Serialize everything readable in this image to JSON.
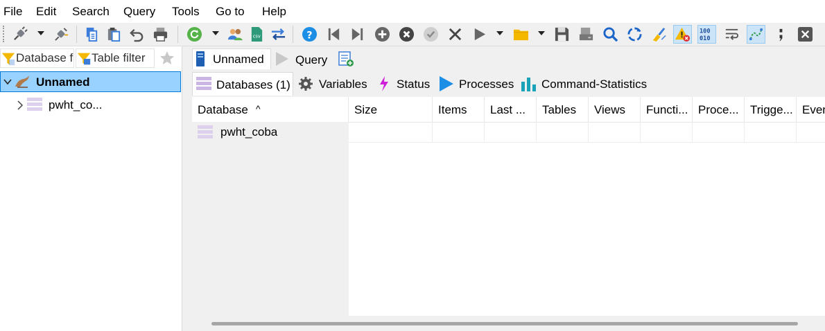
{
  "menu": [
    "File",
    "Edit",
    "Search",
    "Query",
    "Tools",
    "Go to",
    "Help"
  ],
  "left_pane": {
    "database_filter_placeholder": "Database filter",
    "table_filter_placeholder": "Table filter",
    "tree": {
      "session": "Unnamed",
      "databases": [
        "pwht_co..."
      ]
    }
  },
  "query_tabs": [
    "Unnamed",
    "Query"
  ],
  "host_tabs": [
    {
      "label": "Databases (1)",
      "active": true
    },
    {
      "label": "Variables"
    },
    {
      "label": "Status"
    },
    {
      "label": "Processes"
    },
    {
      "label": "Command-Statistics"
    }
  ],
  "grid": {
    "columns": [
      "Database",
      "Size",
      "Items",
      "Last ...",
      "Tables",
      "Views",
      "Functi...",
      "Proce...",
      "Trigge...",
      "Even"
    ],
    "sort_indicator": "^",
    "rows": [
      {
        "Database": "pwht_coba"
      }
    ]
  },
  "colors": {
    "selection": "#99d1ff",
    "accent": "#0078d7",
    "header_bg": "#ffffff",
    "pane_bg": "#f0f0f0"
  }
}
